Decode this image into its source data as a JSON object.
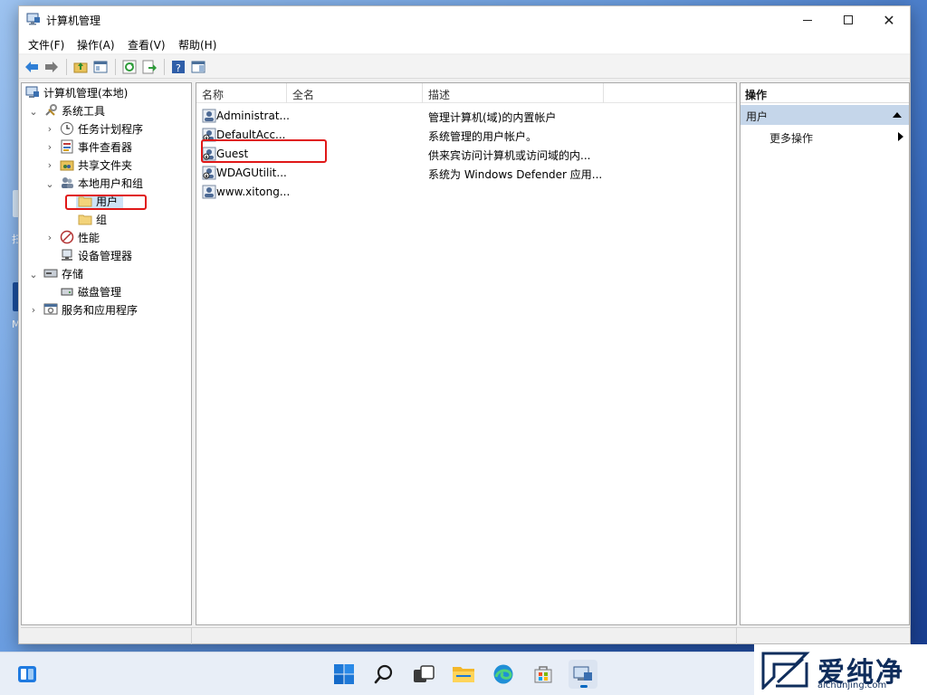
{
  "window": {
    "title": "计算机管理"
  },
  "desktop": {
    "frag_label_1": "扫",
    "frag_label_2": "M"
  },
  "menu": [
    "文件(F)",
    "操作(A)",
    "查看(V)",
    "帮助(H)"
  ],
  "tree": {
    "root": "计算机管理(本地)",
    "system_tools": "系统工具",
    "task_scheduler": "任务计划程序",
    "event_viewer": "事件查看器",
    "shared_folders": "共享文件夹",
    "local_users_groups": "本地用户和组",
    "users": "用户",
    "groups": "组",
    "performance": "性能",
    "device_manager": "设备管理器",
    "storage": "存储",
    "disk_management": "磁盘管理",
    "services_apps": "服务和应用程序"
  },
  "list": {
    "columns": [
      "名称",
      "全名",
      "描述"
    ],
    "rows": [
      {
        "name": "Administrat...",
        "fullname": "",
        "desc": "管理计算机(域)的内置帐户"
      },
      {
        "name": "DefaultAcc...",
        "fullname": "",
        "desc": "系统管理的用户帐户。"
      },
      {
        "name": "Guest",
        "fullname": "",
        "desc": "供来宾访问计算机或访问域的内..."
      },
      {
        "name": "WDAGUtilit...",
        "fullname": "",
        "desc": "系统为 Windows Defender 应用..."
      },
      {
        "name": "www.xitong...",
        "fullname": "",
        "desc": ""
      }
    ]
  },
  "actions": {
    "header": "操作",
    "section": "用户",
    "more": "更多操作"
  },
  "watermark": {
    "text": "爱纯净",
    "url": "aichunjing.com"
  },
  "colors": {
    "accent": "#0067c0",
    "highlight_box": "#e01818",
    "action_section": "#c5d6ea"
  }
}
